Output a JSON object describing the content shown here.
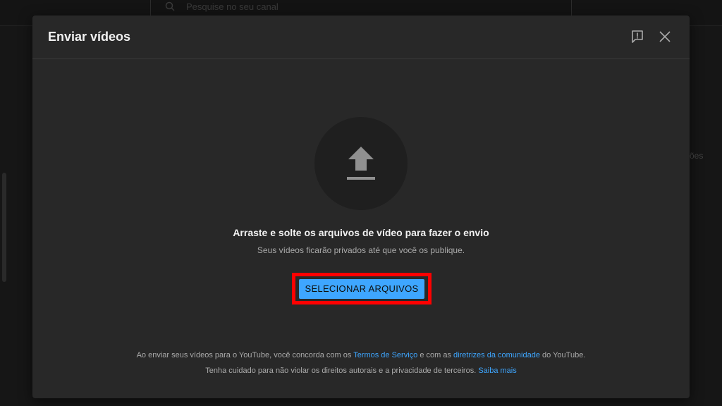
{
  "background": {
    "search_placeholder": "Pesquise no seu canal",
    "right_partial_text": "ões"
  },
  "dialog": {
    "title": "Enviar vídeos",
    "main_text": "Arraste e solte os arquivos de vídeo para fazer o envio",
    "sub_text": "Seus vídeos ficarão privados até que você os publique.",
    "select_button_label": "SELECIONAR ARQUIVOS",
    "footer": {
      "line1_prefix": "Ao enviar seus vídeos para o YouTube, você concorda com os",
      "terms_link": "Termos de Serviço",
      "line1_middle": "e com as",
      "guidelines_link": "diretrizes da comunidade",
      "line1_suffix": "do YouTube.",
      "line2_text": "Tenha cuidado para não violar os direitos autorais e a privacidade de terceiros.",
      "learn_more_link": "Saiba mais"
    }
  },
  "icons": {
    "search": "search-icon",
    "feedback": "feedback-icon",
    "close": "close-icon",
    "upload": "upload-arrow-icon"
  },
  "colors": {
    "accent": "#3ea6ff",
    "highlight": "#ff0000",
    "dialog_bg": "#282828",
    "upload_circle_bg": "#1f1f1f"
  }
}
